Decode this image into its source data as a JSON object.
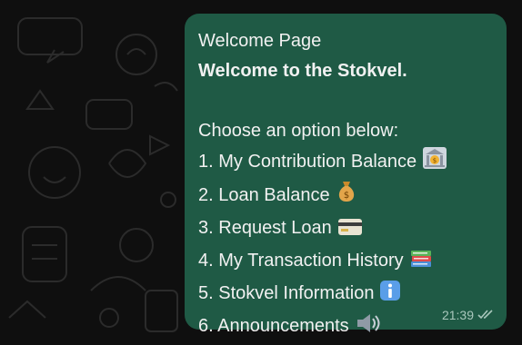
{
  "message": {
    "header": "Welcome Page",
    "title": "Welcome to the Stokvel.",
    "prompt": "Choose an option below:",
    "options": [
      {
        "number": "1.",
        "label": "My Contribution Balance",
        "emoji": "bank-icon"
      },
      {
        "number": "2.",
        "label": "Loan Balance",
        "emoji": "money-bag-icon"
      },
      {
        "number": "3.",
        "label": "Request Loan",
        "emoji": "credit-card-icon"
      },
      {
        "number": "4.",
        "label": "My Transaction History",
        "emoji": "books-icon"
      },
      {
        "number": "5.",
        "label": "Stokvel Information",
        "emoji": "info-icon"
      },
      {
        "number": "6.",
        "label": "Announcements",
        "emoji": "speaker-icon"
      }
    ],
    "time": "21:39",
    "status_icon": "double-check-icon"
  },
  "colors": {
    "bubble": "#1f5a45",
    "background": "#0f0f0f",
    "text": "#f1f1f1",
    "meta": "#a9c7bc"
  }
}
